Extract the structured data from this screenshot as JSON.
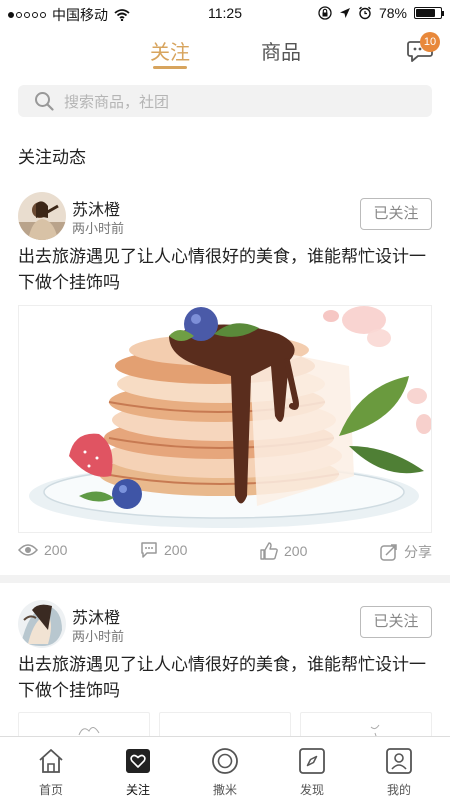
{
  "status_bar": {
    "carrier": "中国移动",
    "time": "11:25",
    "battery": "78%",
    "battery_level": 0.78
  },
  "top_nav": {
    "tabs": [
      {
        "label": "关注",
        "active": true
      },
      {
        "label": "商品",
        "active": false
      }
    ],
    "message_badge": "10"
  },
  "search": {
    "placeholder": "搜索商品，社团"
  },
  "section_title": "关注动态",
  "posts": [
    {
      "author": "苏沐橙",
      "time": "两小时前",
      "follow_label": "已关注",
      "text": "出去旅游遇见了让人心情很好的美食，谁能帮忙设计一下做个挂饰吗",
      "views": "200",
      "comments": "200",
      "likes": "200",
      "share_label": "分享"
    },
    {
      "author": "苏沐橙",
      "time": "两小时前",
      "follow_label": "已关注",
      "text": "出去旅游遇见了让人心情很好的美食，谁能帮忙设计一下做个挂饰吗"
    }
  ],
  "tabbar": {
    "items": [
      {
        "label": "首页",
        "icon": "home-icon"
      },
      {
        "label": "关注",
        "icon": "heart-icon",
        "active": true
      },
      {
        "label": "撒米",
        "icon": "coin-icon"
      },
      {
        "label": "发现",
        "icon": "compass-icon"
      },
      {
        "label": "我的",
        "icon": "user-icon"
      }
    ]
  },
  "colors": {
    "accent": "#d7a45e",
    "badge": "#e8883a",
    "muted": "#999999"
  }
}
